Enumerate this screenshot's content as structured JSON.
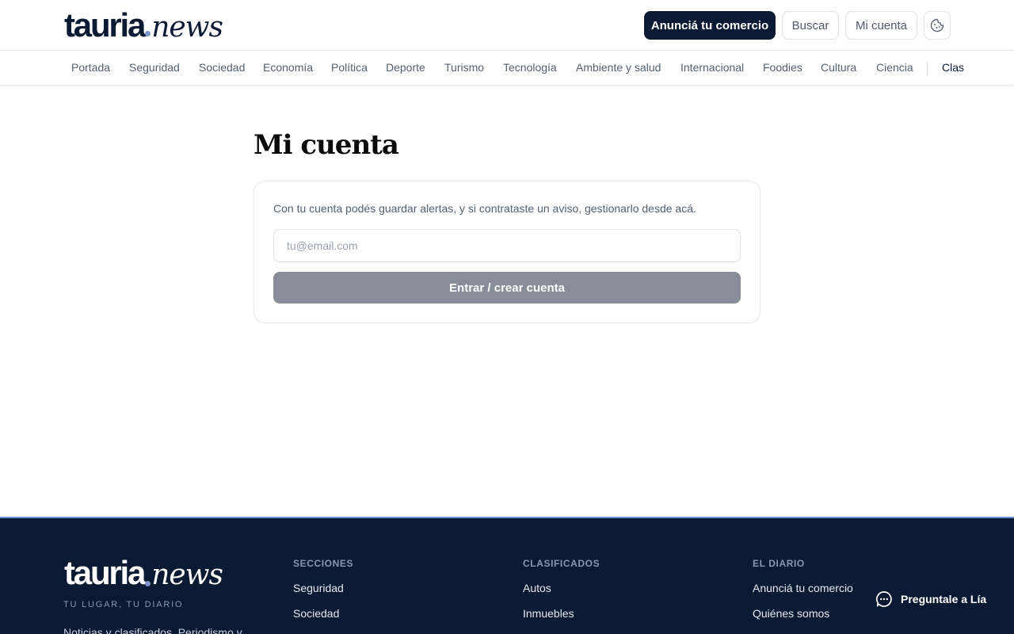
{
  "header": {
    "logo_main": "tauria",
    "logo_news": "news",
    "cta_label": "Anunciá tu comercio",
    "search_label": "Buscar",
    "account_label": "Mi cuenta",
    "cookie_icon": "cookie-icon"
  },
  "nav": {
    "items": [
      "Portada",
      "Seguridad",
      "Sociedad",
      "Economía",
      "Política",
      "Deporte",
      "Turismo",
      "Tecnología",
      "Ambiente y salud",
      "Internacional",
      "Foodies",
      "Cultura",
      "Ciencia"
    ],
    "extra": "Clas"
  },
  "main": {
    "title": "Mi cuenta",
    "description": "Con tu cuenta podés guardar alertas, y si contrataste un aviso, gestionarlo desde acá.",
    "email_placeholder": "tu@email.com",
    "email_value": "",
    "submit_label": "Entrar / crear cuenta"
  },
  "footer": {
    "logo_main": "tauria",
    "logo_news": "news",
    "tagline": "TU LUGAR, TU DIARIO",
    "description": "Noticias y clasificados. Periodismo y",
    "columns": [
      {
        "heading": "SECCIONES",
        "links": [
          "Seguridad",
          "Sociedad"
        ]
      },
      {
        "heading": "CLASIFICADOS",
        "links": [
          "Autos",
          "Inmuebles"
        ]
      },
      {
        "heading": "EL DIARIO",
        "links": [
          "Anunciá tu comercio",
          "Quiénes somos"
        ]
      }
    ]
  },
  "chat": {
    "label": "Preguntale a Lía",
    "icon": "chat-bubble-icon"
  },
  "colors": {
    "navy": "#0b1a33",
    "accent_dot": "#7b93c9",
    "disabled_button": "#878e99",
    "footer_border": "#6f8fd6"
  }
}
